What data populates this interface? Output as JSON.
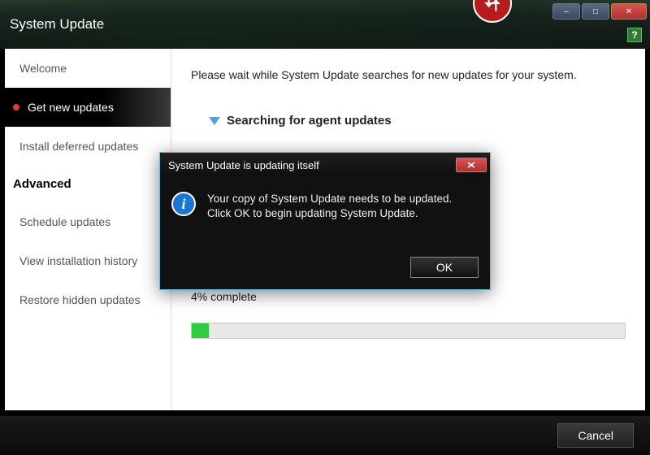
{
  "app": {
    "title": "System Update"
  },
  "window_controls": {
    "minimize": "–",
    "maximize": "□",
    "close": "✕"
  },
  "help_label": "?",
  "sidebar": {
    "items": [
      {
        "label": "Welcome",
        "selected": false
      },
      {
        "label": "Get new updates",
        "selected": true
      },
      {
        "label": "Install deferred updates",
        "selected": false
      }
    ],
    "advanced_header": "Advanced",
    "advanced_items": [
      {
        "label": "Schedule updates"
      },
      {
        "label": "View installation history"
      },
      {
        "label": "Restore hidden updates"
      }
    ]
  },
  "content": {
    "intro_text": "Please wait while System Update searches for new updates for your system.",
    "status_text": "Searching for agent updates",
    "progress_label": "4% complete",
    "progress_percent": 4
  },
  "footer": {
    "cancel_label": "Cancel"
  },
  "dialog": {
    "title": "System Update is updating itself",
    "message": "Your copy of System Update needs to be updated. Click OK to begin updating System Update.",
    "ok_label": "OK",
    "close": "✕"
  }
}
